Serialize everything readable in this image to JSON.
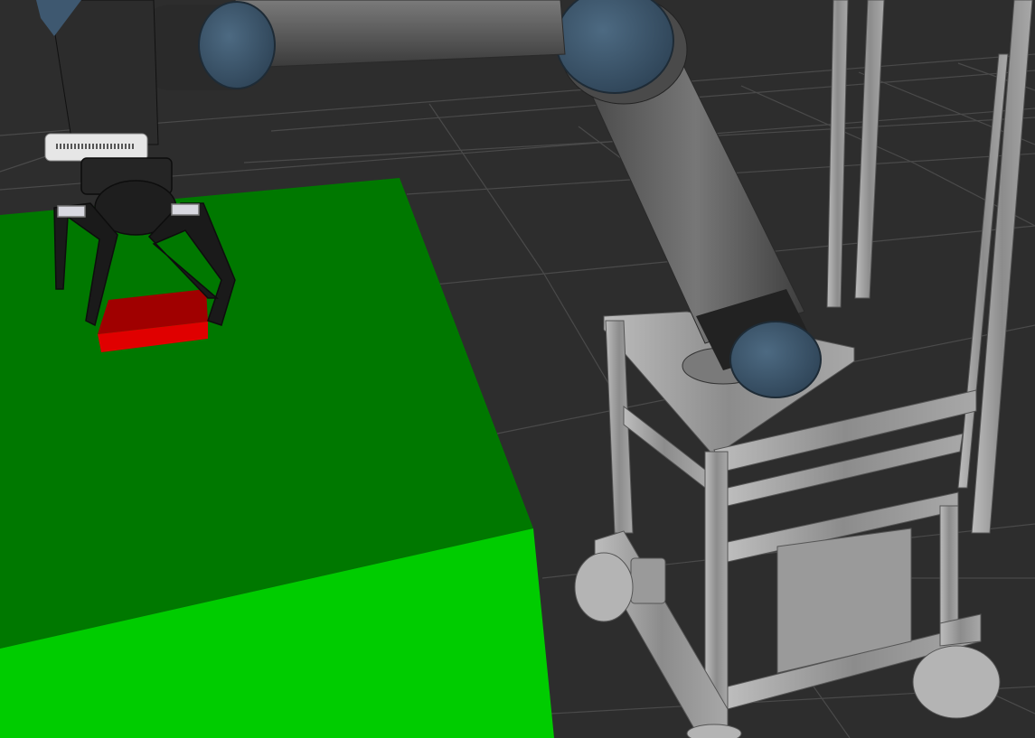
{
  "scene": {
    "background_color": "#2d2d2d",
    "grid_line_color": "#4a4a4a",
    "table_top_color": "#007800",
    "table_front_color": "#00cc00",
    "block_top_color": "#a00000",
    "block_front_color": "#e00000",
    "arm_link_color": "#5c5c5c",
    "arm_joint_cap_color": "#3d5468",
    "gripper_color": "#1e1e1e",
    "frame_color": "#9a9a9a",
    "wheel_color": "#b4b4b4"
  }
}
